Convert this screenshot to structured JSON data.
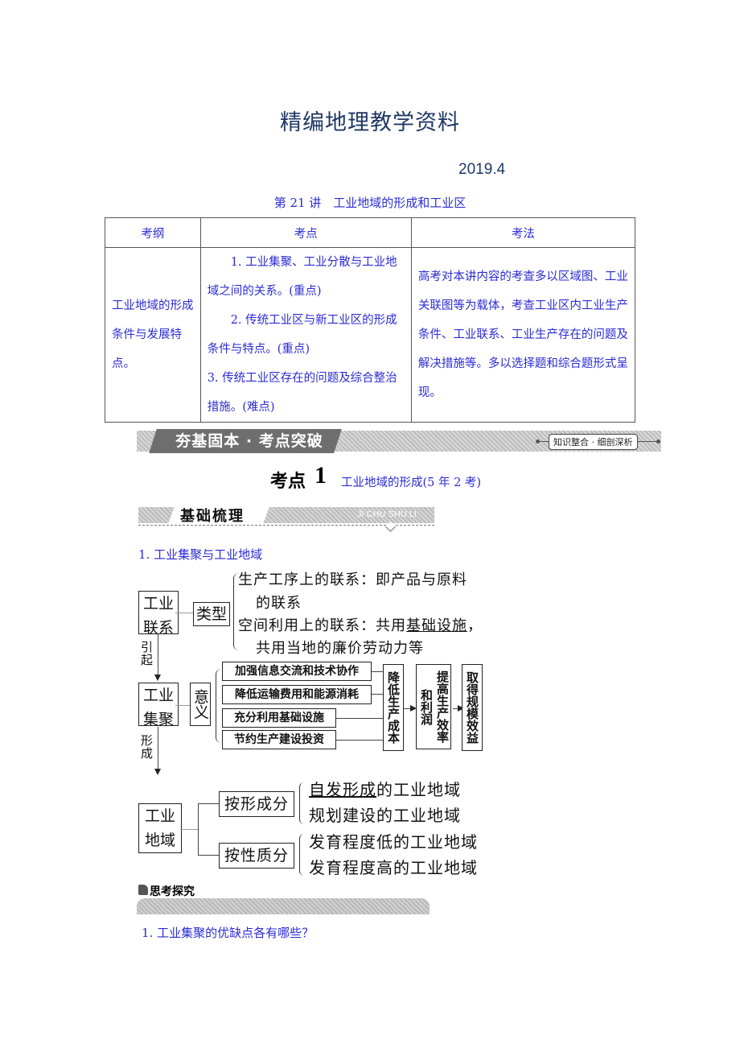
{
  "header": {
    "title": "精编地理教学资料",
    "date": "2019.4",
    "lecture": "第 21 讲　工业地域的形成和工业区"
  },
  "exam_table": {
    "headers": [
      "考纲",
      "考点",
      "考法"
    ],
    "outline": "工业地域的形成条件与发展特点。",
    "points": [
      "1. 工业集聚、工业分散与工业地域之间的关系。(重点)",
      "2. 传统工业区与新工业区的形成条件与特点。(重点)",
      "3. 传统工业区存在的问题及综合整治措施。(难点)"
    ],
    "method": "高考对本讲内容的考查多以区域图、工业关联图等为载体，考查工业区内工业生产条件、工业联系、工业生产存在的问题及解决措施等。多以选择题和综合题形式呈现。"
  },
  "section_band": {
    "title": "夯基固本 · 考点突破",
    "tag": "知识整合 · 细剖深析"
  },
  "topic": {
    "label": "考点",
    "number": "1",
    "desc": "工业地域的形成(5 年 2 考)"
  },
  "basics": {
    "title": "基础梳理",
    "pinyin": "JI CHU SHU LI",
    "section1": "1. 工业集聚与工业地域"
  },
  "diagram": {
    "industrial_link": "工业联系",
    "type_box": "类型",
    "type_items": [
      {
        "line1": "生产工序上的联系：即产品与原料",
        "line2": "的联系"
      },
      {
        "line1_prefix": "空间利用上的联系：共用",
        "line1_underlined": "基础设施",
        "line1_suffix": "，",
        "line2": "共用当地的廉价劳动力等"
      }
    ],
    "arrow1_label": "引起",
    "agglomeration": "工业集聚",
    "meaning_box": "意义",
    "meaning_items": [
      "加强信息交流和技术协作",
      "降低运输费用和能源消耗",
      "充分利用基础设施",
      "节约生产建设投资"
    ],
    "result1": "降低生产成本",
    "result2": "提高生产效率和利润",
    "result3": "取得规模效益",
    "arrow2_label": "形成",
    "region": "工业地域",
    "by_formation": "按形成分",
    "formation_items": [
      {
        "underlined": "自发形成",
        "rest": "的工业地域"
      },
      {
        "underlined": "",
        "rest": "规划建设的工业地域"
      }
    ],
    "by_nature": "按性质分",
    "nature_items": [
      "发育程度低的工业地域",
      "发育程度高的工业地域"
    ]
  },
  "think": {
    "label": "思考探究",
    "question1": "1. 工业集聚的优缺点各有哪些？"
  }
}
